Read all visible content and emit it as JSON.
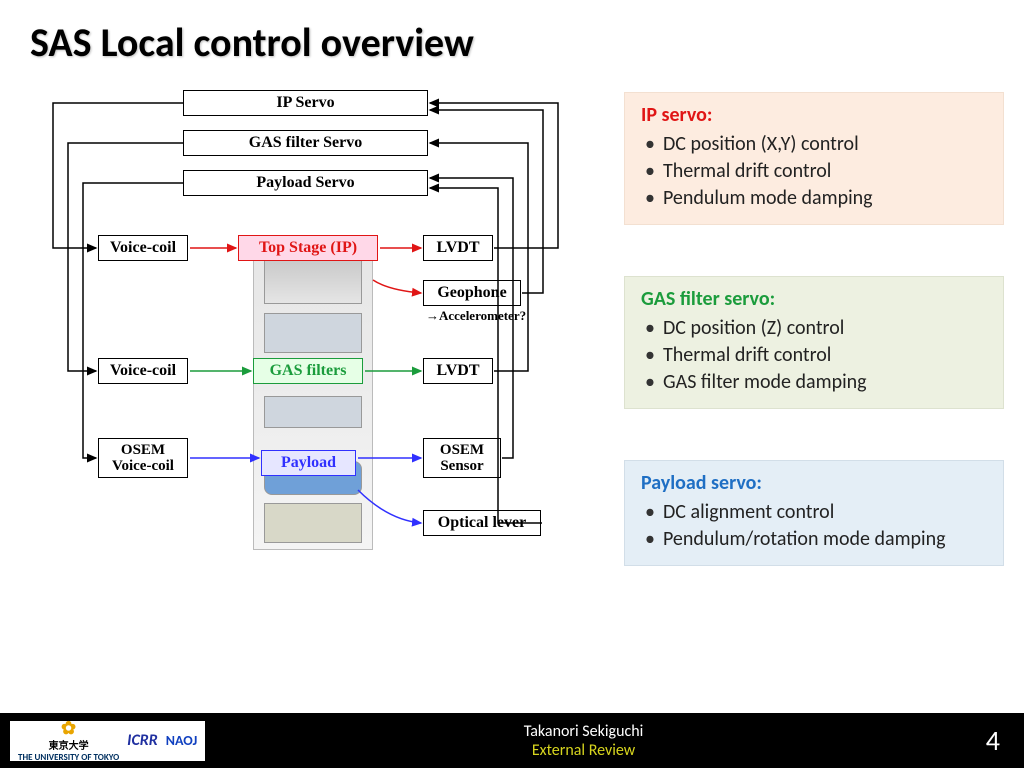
{
  "title": "SAS Local control overview",
  "diagram": {
    "servo_boxes": {
      "ip": "IP Servo",
      "gas": "GAS filter Servo",
      "pay": "Payload Servo"
    },
    "left_actuators": {
      "vc1": "Voice-coil",
      "vc2": "Voice-coil",
      "osem_vc": "OSEM\nVoice-coil"
    },
    "stages": {
      "top": "Top Stage (IP)",
      "gas": "GAS filters",
      "pay": "Payload"
    },
    "right_sensors": {
      "lvdt1": "LVDT",
      "geo": "Geophone",
      "geo_note": "→Accelerometer?",
      "lvdt2": "LVDT",
      "osem_s": "OSEM\nSensor",
      "opt": "Optical lever"
    }
  },
  "cards": {
    "ip": {
      "heading": "IP servo:",
      "items": [
        "DC position (X,Y) control",
        "Thermal drift control",
        "Pendulum mode damping"
      ]
    },
    "gas": {
      "heading": "GAS filter servo:",
      "items": [
        "DC position (Z) control",
        "Thermal drift control",
        "GAS filter mode damping"
      ]
    },
    "pay": {
      "heading": "Payload servo:",
      "items": [
        "DC alignment control",
        "Pendulum/rotation mode damping"
      ]
    }
  },
  "footer": {
    "logos": {
      "utokyo": "THE UNIVERSITY OF TOKYO",
      "utokyo_jp": "東京大学",
      "icrr": "ICRR",
      "naoj": "NAOJ"
    },
    "author": "Takanori Sekiguchi",
    "event": "External Review",
    "page": "4"
  },
  "colors": {
    "red": "#e01515",
    "green": "#1b9c3c",
    "blue": "#3030ff"
  }
}
